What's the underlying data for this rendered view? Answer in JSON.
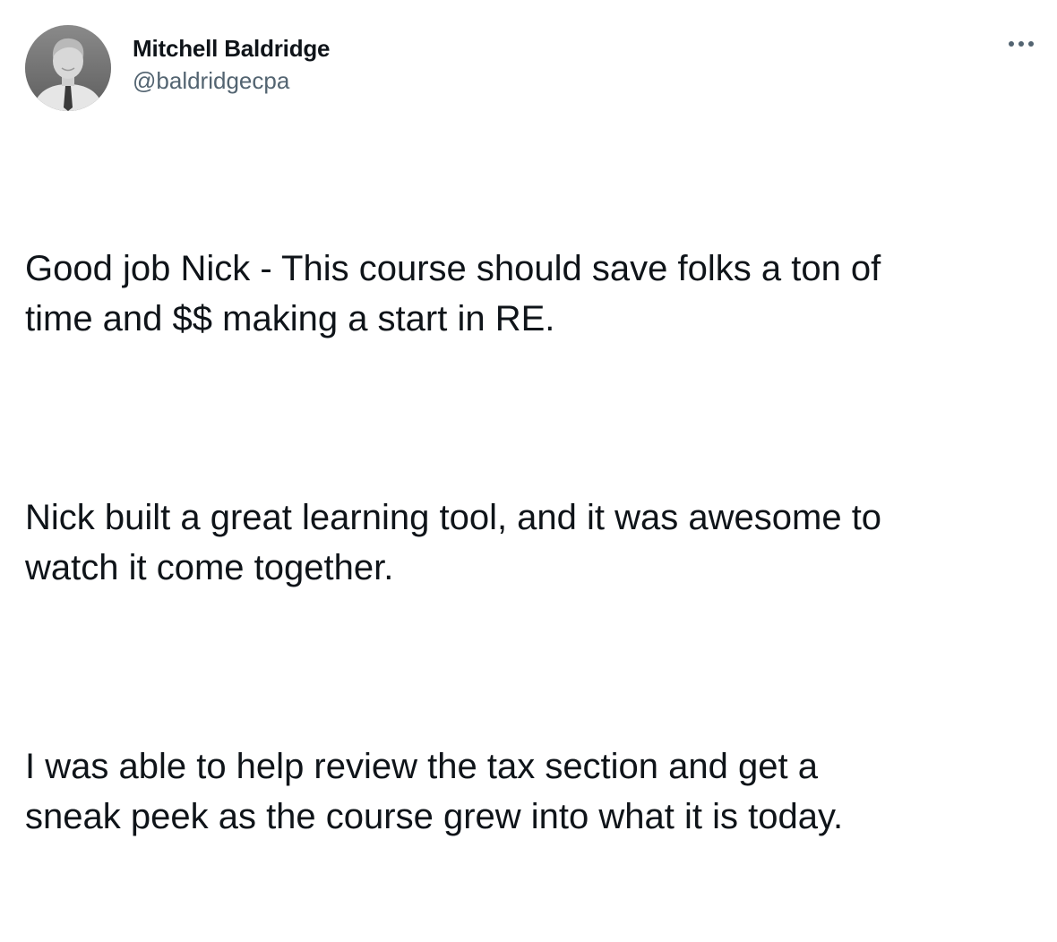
{
  "author": {
    "display_name": "Mitchell Baldridge",
    "handle": "@baldridgecpa",
    "avatar_icon": "user-avatar-photo"
  },
  "menu": {
    "icon": "more-dots-icon"
  },
  "tweet": {
    "paragraphs": [
      "Good job Nick - This course should save folks a ton of\ntime and $$ making a start in RE.",
      "Nick built a great learning tool, and it was awesome to\nwatch it come together.",
      "I was able to help review the tax section and get a\nsneak peek as the course grew into what it is today."
    ]
  },
  "colors": {
    "text_primary": "#0f1419",
    "text_secondary": "#536471",
    "background": "#ffffff"
  }
}
